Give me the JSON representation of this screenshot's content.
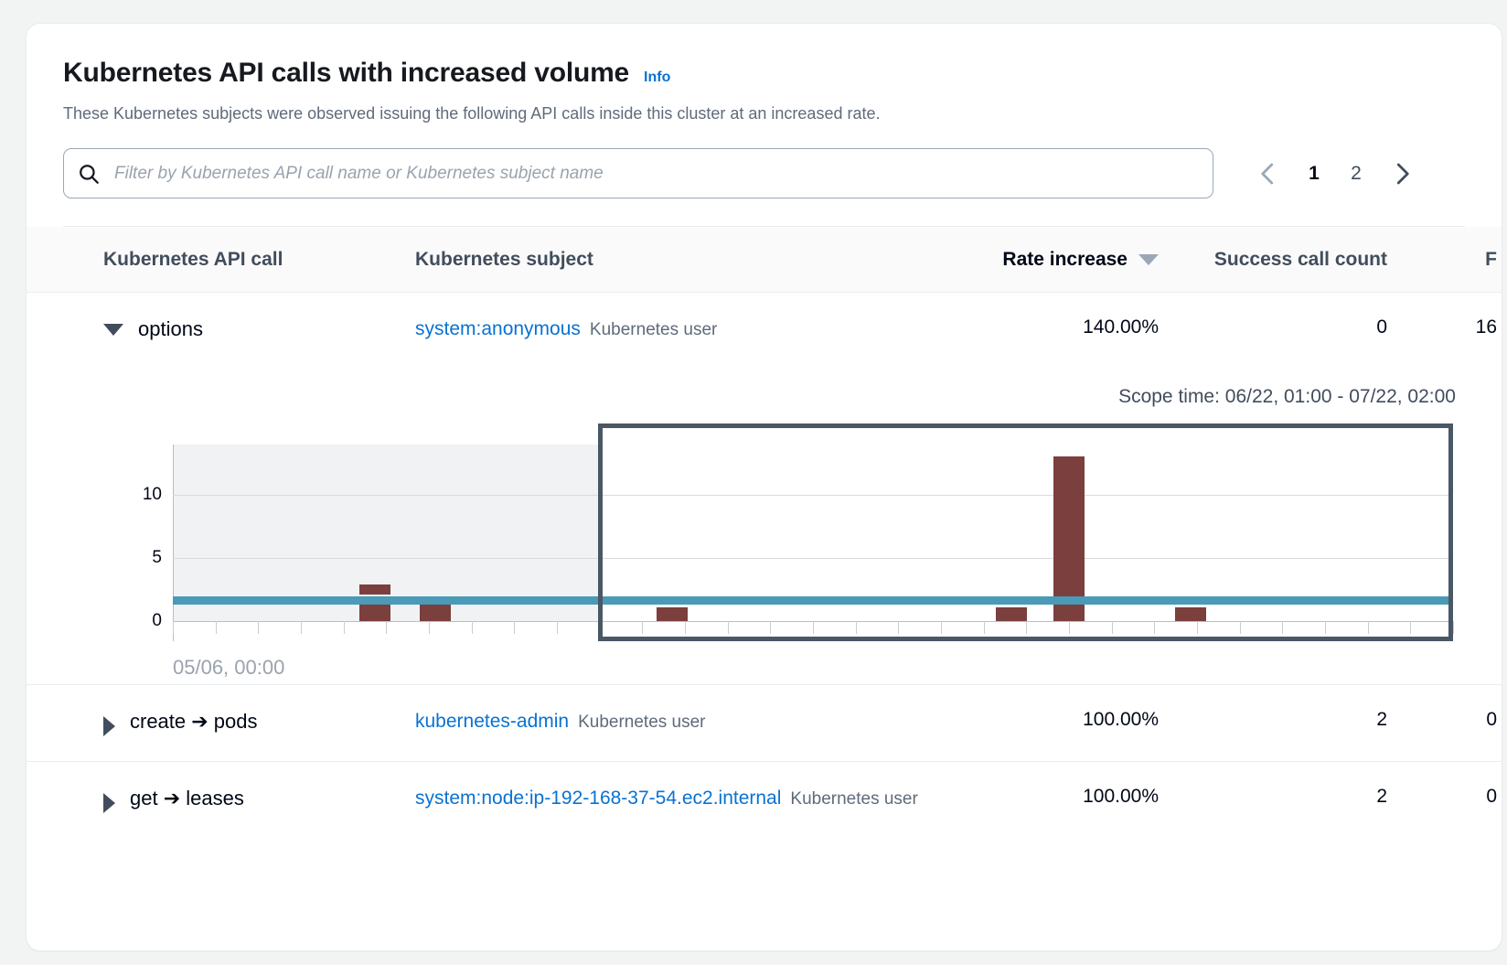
{
  "header": {
    "title": "Kubernetes API calls with increased volume",
    "info_label": "Info",
    "description": "These Kubernetes subjects were observed issuing the following API calls inside this cluster at an increased rate."
  },
  "search": {
    "placeholder": "Filter by Kubernetes API call name or Kubernetes subject name",
    "value": "",
    "icon": "search-icon"
  },
  "pagination": {
    "prev_icon": "chevron-left-icon",
    "next_icon": "chevron-right-icon",
    "pages": [
      "1",
      "2"
    ],
    "current": "1"
  },
  "table": {
    "columns": [
      {
        "key": "api",
        "label": "Kubernetes API call"
      },
      {
        "key": "subject",
        "label": "Kubernetes subject"
      },
      {
        "key": "rate",
        "label": "Rate increase",
        "sorted": true,
        "sort_icon": "sort-descending-caret-icon"
      },
      {
        "key": "success",
        "label": "Success call count"
      },
      {
        "key": "fail",
        "label": "F"
      }
    ],
    "rows": [
      {
        "expanded": true,
        "expander_icon": "triangle-down-icon",
        "api": "options",
        "subject": "system:anonymous",
        "subject_kind": "Kubernetes user",
        "rate": "140.00%",
        "success": "0",
        "fail": "16"
      },
      {
        "expanded": false,
        "expander_icon": "triangle-right-icon",
        "api": "create ➔ pods",
        "subject": "kubernetes-admin",
        "subject_kind": "Kubernetes user",
        "rate": "100.00%",
        "success": "2",
        "fail": "0"
      },
      {
        "expanded": false,
        "expander_icon": "triangle-right-icon",
        "api": "get ➔ leases",
        "subject": "system:node:ip-192-168-37-54.ec2.internal",
        "subject_kind": "Kubernetes user",
        "rate": "100.00%",
        "success": "2",
        "fail": "0"
      }
    ]
  },
  "detail_chart": {
    "scope_time_label": "Scope time: 06/22, 01:00 - 07/22, 02:00"
  },
  "chart_data": {
    "type": "bar",
    "title": "",
    "xlabel": "",
    "ylabel": "",
    "ylim": [
      0,
      14
    ],
    "yticks": [
      0,
      5,
      10
    ],
    "ytick_labels": [
      "0",
      "5",
      "10"
    ],
    "xtick_labels": [
      "05/06, 00:00"
    ],
    "grid": true,
    "legend": "none",
    "bar_color": "#7b3f3e",
    "threshold": {
      "value": 1.7,
      "color": "#4a9ab8",
      "label": ""
    },
    "selection": {
      "label": "Scope time: 06/22, 01:00 - 07/22, 02:00",
      "border_color": "#4a5765",
      "x_start_frac": 0.332,
      "x_end_frac": 1.0
    },
    "out_of_scope_shading": {
      "color": "#f1f2f3",
      "x_start_frac": 0.0,
      "x_end_frac": 0.332
    },
    "bars": [
      {
        "x_frac": 0.158,
        "value": 1.7,
        "base": 0
      },
      {
        "x_frac": 0.158,
        "value": 0.85,
        "base": 2.1
      },
      {
        "x_frac": 0.205,
        "value": 1.6,
        "base": 0
      },
      {
        "x_frac": 0.39,
        "value": 1.1,
        "base": 0
      },
      {
        "x_frac": 0.655,
        "value": 1.1,
        "base": 0
      },
      {
        "x_frac": 0.7,
        "value": 13.1,
        "base": 0
      },
      {
        "x_frac": 0.795,
        "value": 1.1,
        "base": 0
      }
    ]
  }
}
